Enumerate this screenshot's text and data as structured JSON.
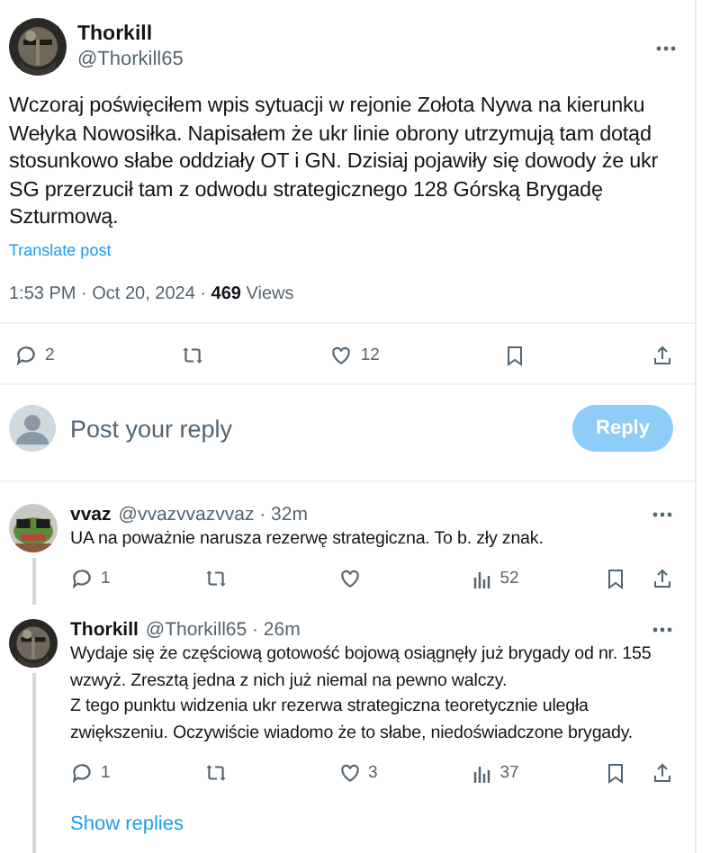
{
  "post": {
    "author": "Thorkill",
    "handle": "@Thorkill65",
    "text": "Wczoraj poświęciłem wpis sytuacji w rejonie Zołota Nywa na kierunku Wełyka Nowosiłka. Napisałem że ukr linie obrony utrzymują tam dotąd stosunkowo słabe oddziały OT i GN. Dzisiaj pojawiły się dowody że ukr SG przerzucił tam z odwodu strategicznego 128 Górską Brygadę Szturmową.",
    "translate": "Translate post",
    "time": "1:53 PM · Oct 20, 2024 · ",
    "views": "469",
    "views_label": " Views",
    "actions": [
      {
        "kind": "reply",
        "count": "2"
      },
      {
        "kind": "repost"
      },
      {
        "kind": "like",
        "count": "12"
      },
      {
        "kind": "bookmark"
      },
      {
        "kind": "share"
      }
    ]
  },
  "reply_box": {
    "placeholder": "Post your reply",
    "button": "Reply",
    "disabled": true
  },
  "replies": [
    {
      "author": "vvaz",
      "handle": "@vvazvvazvvaz · 32m",
      "connected": true,
      "paragraphs": [
        "UA na poważnie narusza rezerwę strategiczna. To b. zły znak."
      ],
      "actions": [
        {
          "kind": "reply",
          "count": "1"
        },
        {
          "kind": "repost"
        },
        {
          "kind": "like"
        },
        {
          "kind": "views",
          "count": "52"
        },
        {
          "kind": "bookmark"
        },
        {
          "kind": "share"
        }
      ]
    },
    {
      "author": "Thorkill",
      "handle": "@Thorkill65 · 26m",
      "connected": true,
      "paragraphs": [
        "Wydaje się że częściową gotowość bojową osiągnęły już brygady od nr. 155 wzwyż. Zresztą jedna z nich już niemal na pewno walczy.",
        "Z tego punktu widzenia ukr rezerwa strategiczna teoretycznie uległa zwiększeniu. Oczywiście wiadomo że to słabe, niedoświadczone brygady."
      ],
      "actions": [
        {
          "kind": "reply",
          "count": "1"
        },
        {
          "kind": "repost"
        },
        {
          "kind": "like",
          "count": "3"
        },
        {
          "kind": "views",
          "count": "37"
        },
        {
          "kind": "bookmark"
        },
        {
          "kind": "share"
        }
      ]
    }
  ],
  "show_replies": "Show replies"
}
